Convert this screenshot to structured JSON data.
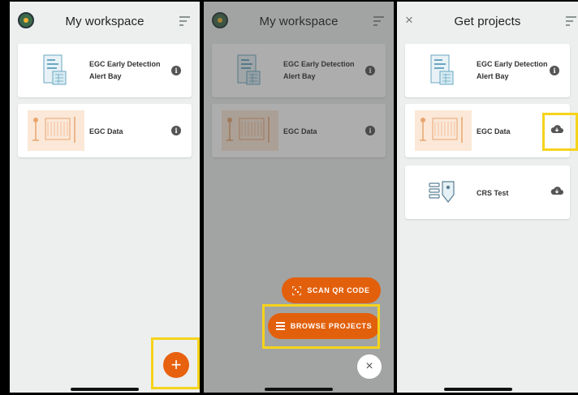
{
  "screens": [
    {
      "title": "My workspace",
      "projects": [
        {
          "name": "EGC Early Detection Alert Bay",
          "action_icon": "info-icon"
        },
        {
          "name": "EGC Data",
          "action_icon": "info-icon"
        }
      ],
      "fab_label": "+",
      "fab_icon": "plus-icon"
    },
    {
      "title": "My workspace",
      "projects": [
        {
          "name": "EGC Early Detection Alert Bay",
          "action_icon": "info-icon"
        },
        {
          "name": "EGC Data",
          "action_icon": "info-icon"
        }
      ],
      "menu": {
        "scan_label": "SCAN QR CODE",
        "browse_label": "BROWSE PROJECTS",
        "close_label": "×"
      }
    },
    {
      "title": "Get projects",
      "close_label": "×",
      "projects": [
        {
          "name": "EGC Early Detection Alert Bay",
          "action_icon": "info-icon"
        },
        {
          "name": "EGC Data",
          "action_icon": "cloud-download-icon"
        },
        {
          "name": "CRS Test",
          "action_icon": "cloud-download-icon"
        }
      ]
    }
  ],
  "info_glyph": "i",
  "colors": {
    "accent": "#e8610f",
    "highlight": "#f6d31b",
    "background": "#ecefee",
    "card": "#ffffff"
  }
}
